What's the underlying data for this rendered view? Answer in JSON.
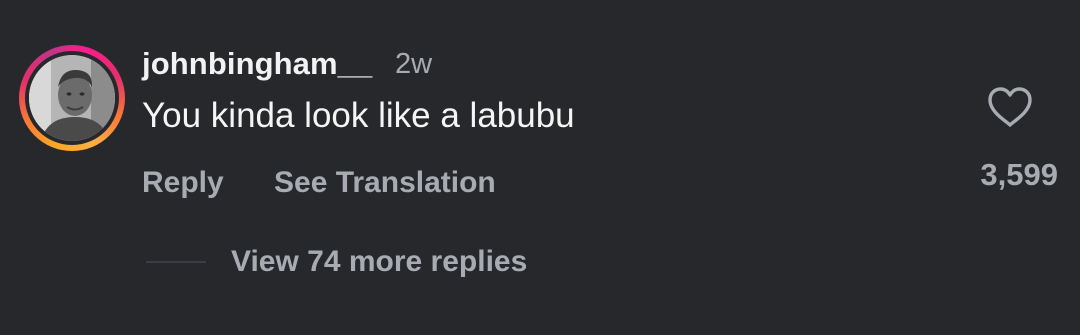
{
  "comment": {
    "username": "johnbingham__",
    "time_ago": "2w",
    "text": "You kinda look like a labubu",
    "like_count": "3,599",
    "liked": false,
    "story_ring_colors": [
      "#fcaf45",
      "#f77737",
      "#e1306c",
      "#c13584",
      "#fd1d8a"
    ]
  },
  "actions": {
    "reply_label": "Reply",
    "translate_label": "See Translation"
  },
  "replies": {
    "view_more_label": "View 74 more replies"
  },
  "icons": {
    "like": "heart-outline-icon"
  },
  "colors": {
    "background": "#26282b",
    "primary_text": "#f2f2f2",
    "secondary_text": "#a8acb2"
  }
}
